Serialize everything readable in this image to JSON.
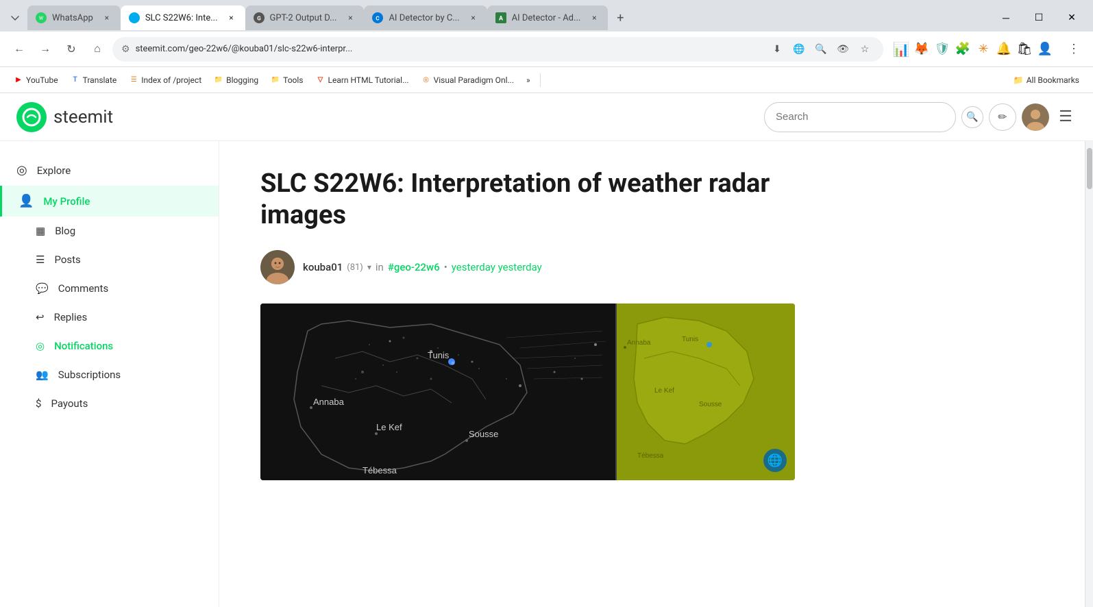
{
  "browser": {
    "tabs": [
      {
        "id": "whatsapp",
        "title": "WhatsApp",
        "favicon_type": "whatsapp",
        "favicon_symbol": "✆",
        "active": false
      },
      {
        "id": "slc",
        "title": "SLC S22W6: Inte...",
        "favicon_type": "slc",
        "favicon_symbol": "◉",
        "active": true
      },
      {
        "id": "gpt",
        "title": "GPT-2 Output D...",
        "favicon_type": "gpt",
        "favicon_symbol": "◑",
        "active": false
      },
      {
        "id": "ai1",
        "title": "AI Detector by C...",
        "favicon_type": "ai",
        "favicon_symbol": "C",
        "active": false
      },
      {
        "id": "ai2",
        "title": "AI Detector - Ad...",
        "favicon_type": "ai2",
        "favicon_symbol": "A",
        "active": false
      }
    ],
    "url": "steemit.com/geo-22w6/@kouba01/slc-s22w6-interpr...",
    "nav": {
      "back_title": "Back",
      "forward_title": "Forward",
      "reload_title": "Reload",
      "home_title": "Home"
    }
  },
  "bookmarks": [
    {
      "id": "youtube",
      "label": "YouTube",
      "favicon": "▶",
      "favicon_color": "#FF0000"
    },
    {
      "id": "translate",
      "label": "Translate",
      "favicon": "T",
      "favicon_color": "#4285F4"
    },
    {
      "id": "index",
      "label": "Index of /project",
      "favicon": "☰",
      "favicon_color": "#e8821a"
    },
    {
      "id": "blogging",
      "label": "Blogging",
      "favicon": "📁",
      "favicon_color": "#888"
    },
    {
      "id": "tools",
      "label": "Tools",
      "favicon": "📁",
      "favicon_color": "#888"
    },
    {
      "id": "html",
      "label": "Learn HTML Tutorial...",
      "favicon": "▽",
      "favicon_color": "#e44d26"
    },
    {
      "id": "vp",
      "label": "Visual Paradigm Onl...",
      "favicon": "◎",
      "favicon_color": "#e07020"
    }
  ],
  "bookmarks_more": "»",
  "all_bookmarks_label": "All Bookmarks",
  "steemit": {
    "logo_name": "steemit",
    "search_placeholder": "Search",
    "header": {
      "search_label": "Search"
    },
    "sidebar": {
      "items": [
        {
          "id": "explore",
          "label": "Explore",
          "icon": "◎"
        },
        {
          "id": "my-profile",
          "label": "My Profile",
          "icon": "👤",
          "active": true
        },
        {
          "id": "blog",
          "label": "Blog",
          "icon": "▦"
        },
        {
          "id": "posts",
          "label": "Posts",
          "icon": "☰"
        },
        {
          "id": "comments",
          "label": "Comments",
          "icon": "💬"
        },
        {
          "id": "replies",
          "label": "Replies",
          "icon": "↩"
        },
        {
          "id": "notifications",
          "label": "Notifications",
          "icon": "◎",
          "highlight": true
        },
        {
          "id": "subscriptions",
          "label": "Subscriptions",
          "icon": "👥"
        },
        {
          "id": "payouts",
          "label": "Payouts",
          "icon": "$"
        }
      ]
    },
    "article": {
      "title": "SLC S22W6: Interpretation of weather radar images",
      "author": "kouba01",
      "author_rep": "(81)",
      "tag": "#geo-22w6",
      "date": "yesterday yesterday",
      "date_separator": "•"
    }
  },
  "map": {
    "cities_left": [
      "Annaba",
      "Tunis",
      "Le Kef",
      "Sousse",
      "Tébessa"
    ],
    "cities_right": [
      "Annaba",
      "Tunis",
      "Sousse",
      "Le Kef",
      "Tébessa"
    ]
  }
}
